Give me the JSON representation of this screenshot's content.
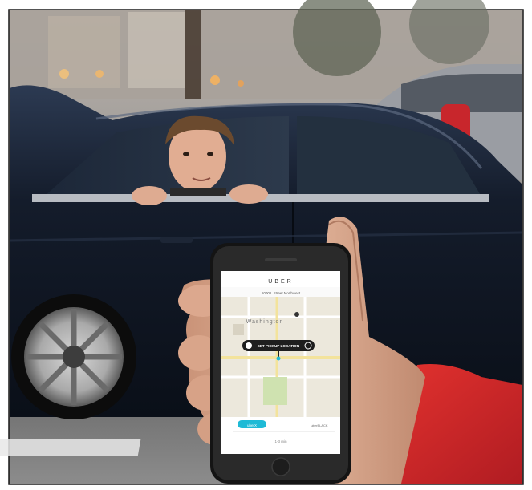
{
  "photo": {
    "description_free": true,
    "phone_app": {
      "brand": "UBER",
      "address_bar": "1000 L Street Northwest",
      "map_city_label": "Washington",
      "pickup_button_label": "SET PICKUP LOCATION",
      "bottom_tabs": [
        "uberX",
        "",
        "uberBLACK"
      ],
      "bottom_hint": "1-3 min",
      "accent_color": "#1fbad6"
    }
  },
  "colors": {
    "frame_border": "#1a1a1a",
    "car_body": "#0f1623",
    "sleeve": "#d8262b",
    "skin": "#d9a88a",
    "map_road_yellow": "#f3e39c",
    "map_park_green": "#cfe2b0"
  }
}
